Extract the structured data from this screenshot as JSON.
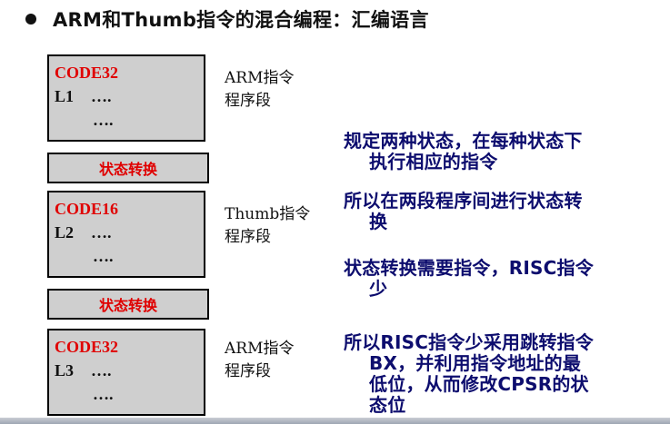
{
  "title": "ARM和Thumb指令的混合编程：汇编语言",
  "blocks": [
    {
      "label": "CODE32",
      "line1_label": "L1",
      "line1_dots": "….",
      "line2_dots": "….",
      "side_line1": "ARM指令",
      "side_line2": "程序段"
    },
    {
      "label": "CODE16",
      "line1_label": "L2",
      "line1_dots": "….",
      "line2_dots": "….",
      "side_line1": "Thumb指令",
      "side_line2": "程序段"
    },
    {
      "label": "CODE32",
      "line1_label": "L3",
      "line1_dots": "….",
      "line2_dots": "….",
      "side_line1": "ARM指令",
      "side_line2": "程序段"
    }
  ],
  "switches": [
    {
      "label": "状态转换"
    },
    {
      "label": "状态转换"
    }
  ],
  "notes": [
    {
      "lines": [
        "规定两种状态，在每种状态下",
        "执行相应的指令"
      ]
    },
    {
      "lines": [
        "所以在两段程序间进行状态转",
        "换"
      ]
    },
    {
      "lines": [
        "状态转换需要指令，RISC指令",
        "少"
      ]
    },
    {
      "lines": [
        "所以RISC指令少采用跳转指令",
        "BX，并利用指令地址的最",
        "低位，从而修改CPSR的状",
        "态位"
      ]
    }
  ],
  "colors": {
    "label_red": "#e00000",
    "note_navy": "#0d0d6e",
    "box_gray": "#cfcfcf"
  }
}
